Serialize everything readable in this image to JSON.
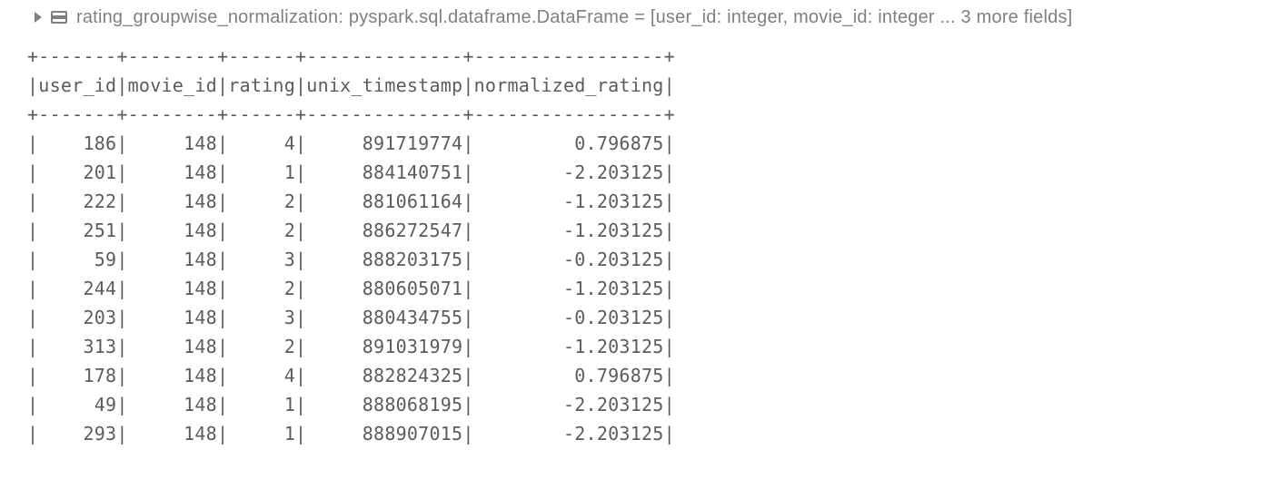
{
  "schema": {
    "var_name": "rating_groupwise_normalization:",
    "type_str": " pyspark.sql.dataframe.DataFrame = [user_id: integer, movie_id: integer ... 3 more fields]"
  },
  "columns": [
    {
      "name": "user_id",
      "width": 7
    },
    {
      "name": "movie_id",
      "width": 8
    },
    {
      "name": "rating",
      "width": 6
    },
    {
      "name": "unix_timestamp",
      "width": 14
    },
    {
      "name": "normalized_rating",
      "width": 17
    }
  ],
  "rows": [
    {
      "user_id": "186",
      "movie_id": "148",
      "rating": "4",
      "unix_timestamp": "891719774",
      "normalized_rating": "0.796875"
    },
    {
      "user_id": "201",
      "movie_id": "148",
      "rating": "1",
      "unix_timestamp": "884140751",
      "normalized_rating": "-2.203125"
    },
    {
      "user_id": "222",
      "movie_id": "148",
      "rating": "2",
      "unix_timestamp": "881061164",
      "normalized_rating": "-1.203125"
    },
    {
      "user_id": "251",
      "movie_id": "148",
      "rating": "2",
      "unix_timestamp": "886272547",
      "normalized_rating": "-1.203125"
    },
    {
      "user_id": "59",
      "movie_id": "148",
      "rating": "3",
      "unix_timestamp": "888203175",
      "normalized_rating": "-0.203125"
    },
    {
      "user_id": "244",
      "movie_id": "148",
      "rating": "2",
      "unix_timestamp": "880605071",
      "normalized_rating": "-1.203125"
    },
    {
      "user_id": "203",
      "movie_id": "148",
      "rating": "3",
      "unix_timestamp": "880434755",
      "normalized_rating": "-0.203125"
    },
    {
      "user_id": "313",
      "movie_id": "148",
      "rating": "2",
      "unix_timestamp": "891031979",
      "normalized_rating": "-1.203125"
    },
    {
      "user_id": "178",
      "movie_id": "148",
      "rating": "4",
      "unix_timestamp": "882824325",
      "normalized_rating": "0.796875"
    },
    {
      "user_id": "49",
      "movie_id": "148",
      "rating": "1",
      "unix_timestamp": "888068195",
      "normalized_rating": "-2.203125"
    },
    {
      "user_id": "293",
      "movie_id": "148",
      "rating": "1",
      "unix_timestamp": "888907015",
      "normalized_rating": "-2.203125"
    }
  ]
}
